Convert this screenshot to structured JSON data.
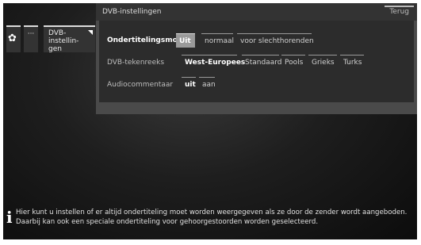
{
  "breadcrumbs": {
    "gear_icon": "gear-icon",
    "more_label": "···",
    "current_label": "DVB-instellin-\ngen"
  },
  "panel": {
    "title": "DVB-instellingen",
    "back_label": "Terug"
  },
  "rows": [
    {
      "label": "Ondertitelingsmodus",
      "active": true,
      "options": [
        "Uit",
        "normaal",
        "voor slechthorenden"
      ],
      "selected": "Uit"
    },
    {
      "label": "DVB-tekenreeks",
      "active": false,
      "options": [
        "West-Europees",
        "Standaard",
        "Pools",
        "Grieks",
        "Turks"
      ],
      "selected": "West-Europees"
    },
    {
      "label": "Audiocommentaar",
      "active": false,
      "options": [
        "uit",
        "aan"
      ],
      "selected": "uit"
    }
  ],
  "info": {
    "icon": "info-icon",
    "text": "Hier kunt u instellen of er altijd ondertiteling moet worden weergegeven als ze door de zender wordt aangeboden. Daarbij kan ook een speciale ondertiteling voor gehoorgestoorden worden geselecteerd."
  }
}
